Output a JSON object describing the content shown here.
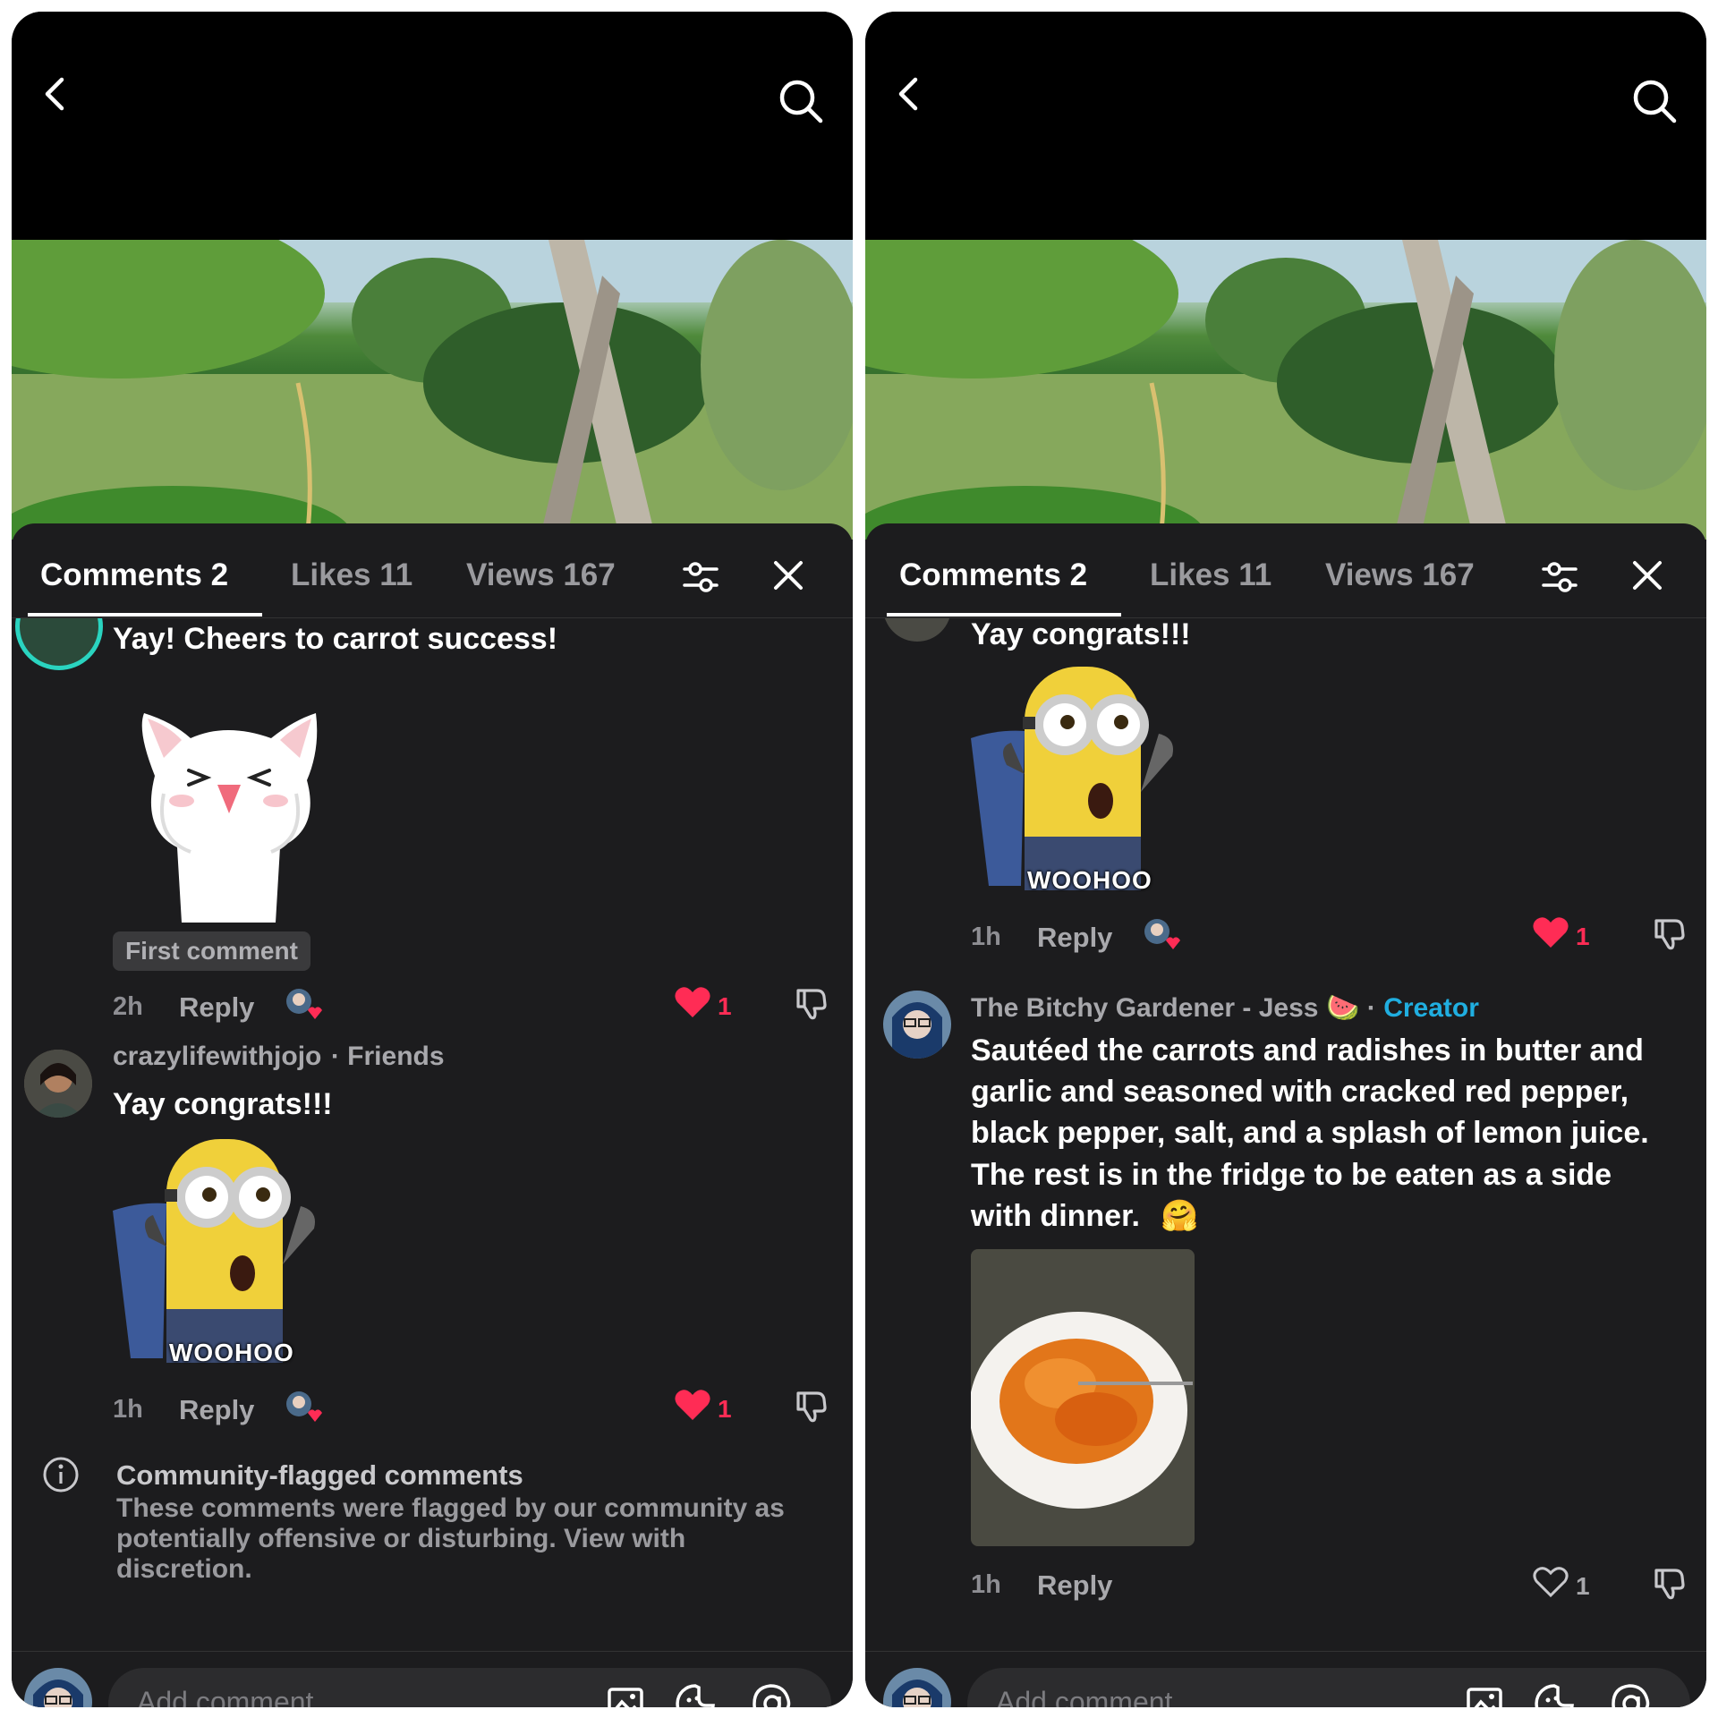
{
  "colors": {
    "like": "#ff2c55",
    "creator": "#20aee0",
    "background": "#1c1c1e"
  },
  "tabs": {
    "comments": "Comments 2",
    "likes": "Likes 11",
    "views": "Views 167"
  },
  "input_placeholder": "Add comment...",
  "left": {
    "comment1": {
      "text": "Yay! Cheers to carrot success!",
      "badge": "First comment",
      "time": "2h",
      "reply": "Reply",
      "likes": "1"
    },
    "comment2": {
      "username": "crazylifewithjojo",
      "relation": "· Friends",
      "text": "Yay congrats!!!",
      "sticker_text": "WOOHOO",
      "time": "1h",
      "reply": "Reply",
      "likes": "1"
    },
    "notice": {
      "title": "Community-flagged comments",
      "line1": "These comments were flagged by our community as",
      "line2": "potentially offensive or disturbing. View with",
      "line3": "discretion."
    }
  },
  "right": {
    "comment1": {
      "text": "Yay congrats!!!",
      "sticker_text": "WOOHOO",
      "time": "1h",
      "reply": "Reply",
      "likes": "1"
    },
    "comment2": {
      "username": "The Bitchy Gardener - Jess",
      "emoji": "🍉",
      "creator_label": "Creator",
      "line1": "Sautéed the carrots and radishes in butter and",
      "line2": "garlic and seasoned with cracked red pepper,",
      "line3": "black pepper, salt, and a splash of lemon juice.",
      "line4": "The rest is in the fridge to be eaten as a side",
      "line5": "with dinner.",
      "line5_emoji": "🤗",
      "time": "1h",
      "reply": "Reply",
      "likes": "1"
    }
  },
  "icons": [
    "back-icon",
    "search-icon",
    "filter-icon",
    "close-icon",
    "heart-icon",
    "dislike-icon",
    "image-icon",
    "emoji-icon",
    "mention-icon",
    "info-icon"
  ]
}
